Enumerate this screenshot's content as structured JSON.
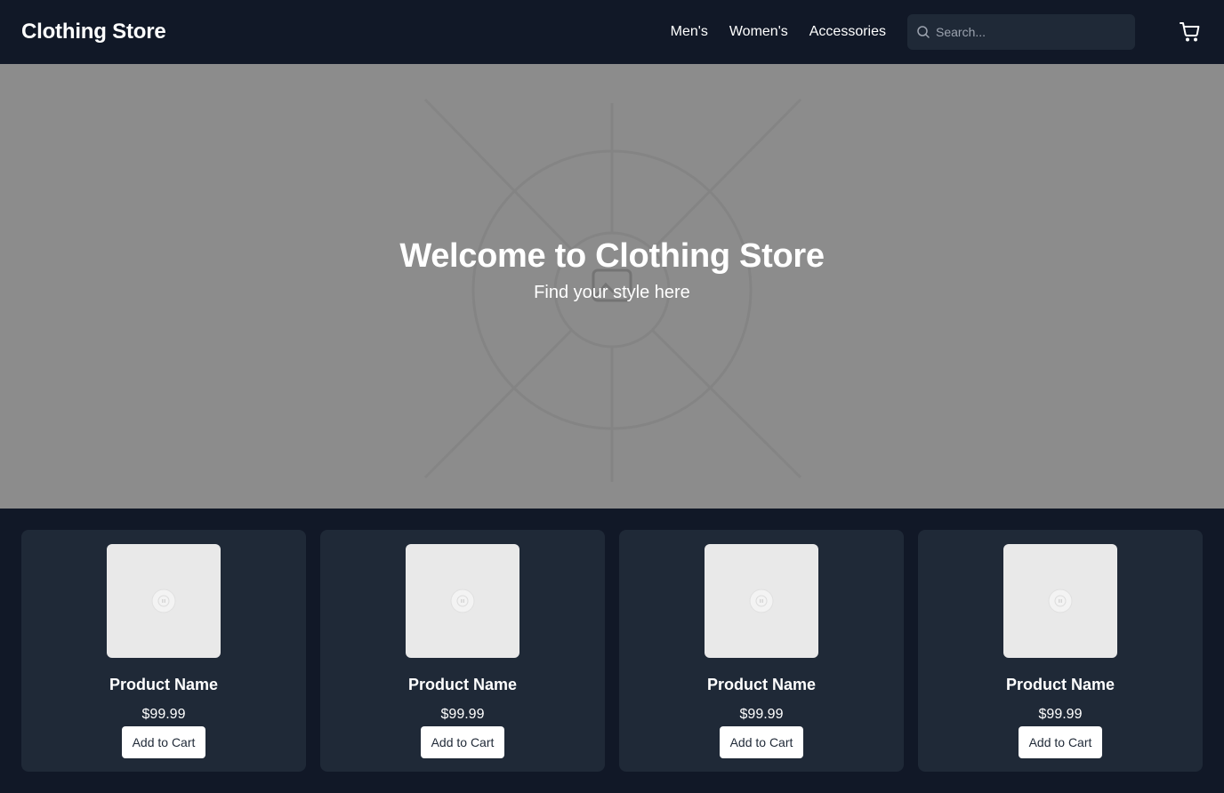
{
  "header": {
    "brand": "Clothing Store",
    "nav": [
      {
        "label": "Men's"
      },
      {
        "label": "Women's"
      },
      {
        "label": "Accessories"
      }
    ],
    "search_placeholder": "Search...",
    "cart_icon": "shopping-cart-icon"
  },
  "hero": {
    "title": "Welcome to Clothing Store",
    "subtitle": "Find your style here",
    "image_icon": "broken-image-icon"
  },
  "products": [
    {
      "name": "Product Name",
      "price": "$99.99",
      "button": "Add to Cart"
    },
    {
      "name": "Product Name",
      "price": "$99.99",
      "button": "Add to Cart"
    },
    {
      "name": "Product Name",
      "price": "$99.99",
      "button": "Add to Cart"
    },
    {
      "name": "Product Name",
      "price": "$99.99",
      "button": "Add to Cart"
    }
  ],
  "colors": {
    "background": "#111827",
    "card": "#1f2937",
    "hero": "#8c8c8c"
  }
}
